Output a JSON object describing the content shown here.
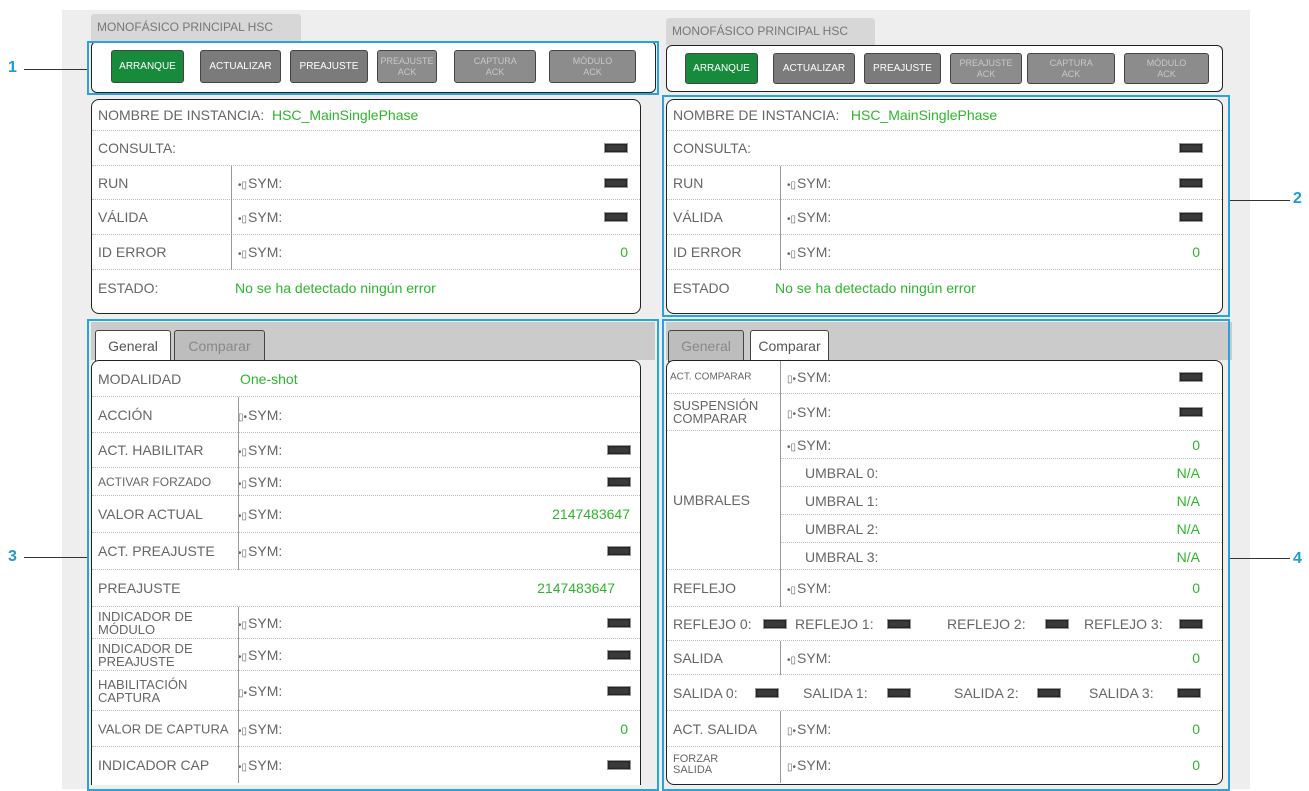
{
  "left": {
    "title": "MONOFÁSICO PRINCIPAL HSC",
    "toolbar": {
      "arranque": "ARRANQUE",
      "actualizar": "ACTUALIZAR",
      "preajuste": "PREAJUSTE",
      "preajuste_ack": "PREAJUSTE ACK",
      "captura_ack": "CAPTURA ACK",
      "modulo_ack": "MÓDULO ACK"
    },
    "instance_label": "NOMBRE DE INSTANCIA:",
    "instance_value": "HSC_MainSinglePhase",
    "consulta": "CONSULTA:",
    "run": "RUN",
    "valida": "VÁLIDA",
    "id_error": "ID ERROR",
    "id_error_value": "0",
    "estado_label": "ESTADO:",
    "estado_value": "No se ha detectado ningún error",
    "sym": "SYM:",
    "tab_general": "General",
    "tab_comparar": "Comparar",
    "modalidad_label": "MODALIDAD",
    "modalidad_value": "One-shot",
    "accion": "ACCIÓN",
    "act_habilitar": "ACT. HABILITAR",
    "activar_forzado": "ACTIVAR FORZADO",
    "valor_actual": "VALOR ACTUAL",
    "valor_actual_value": "2147483647",
    "act_preajuste": "ACT. PREAJUSTE",
    "preajuste_label": "PREAJUSTE",
    "preajuste_value": "2147483647",
    "indicador_modulo": "INDICADOR DE MÓDULO",
    "indicador_preajuste": "INDICADOR DE PREAJUSTE",
    "habilitacion_captura": "HABILITACIÓN CAPTURA",
    "valor_captura": "VALOR DE CAPTURA",
    "valor_captura_value": "0",
    "indicador_cap": "INDICADOR CAP"
  },
  "right": {
    "title": "MONOFÁSICO PRINCIPAL HSC",
    "toolbar": {
      "arranque": "ARRANQUE",
      "actualizar": "ACTUALIZAR",
      "preajuste": "PREAJUSTE",
      "preajuste_ack": "PREAJUSTE ACK",
      "captura_ack": "CAPTURA ACK",
      "modulo_ack": "MÓDULO ACK"
    },
    "instance_label": "NOMBRE DE INSTANCIA:",
    "instance_value": "HSC_MainSinglePhase",
    "consulta": "CONSULTA:",
    "run": "RUN",
    "valida": "VÁLIDA",
    "id_error": "ID ERROR",
    "id_error_value": "0",
    "estado_label": "ESTADO",
    "estado_value": "No se ha detectado ningún error",
    "sym": "SYM:",
    "tab_general": "General",
    "tab_comparar": "Comparar",
    "act_comparar": "ACT. COMPARAR",
    "suspension_comparar": "SUSPENSIÓN COMPARAR",
    "umbrales": "UMBRALES",
    "umbrales_value": "0",
    "umbral0": "UMBRAL 0:",
    "umbral1": "UMBRAL 1:",
    "umbral2": "UMBRAL 2:",
    "umbral3": "UMBRAL 3:",
    "na": "N/A",
    "reflejo": "REFLEJO",
    "reflejo_value": "0",
    "reflejo0": "REFLEJO 0:",
    "reflejo1": "REFLEJO 1:",
    "reflejo2": "REFLEJO 2:",
    "reflejo3": "REFLEJO 3:",
    "salida": "SALIDA",
    "salida_value": "0",
    "salida0": "SALIDA 0:",
    "salida1": "SALIDA 1:",
    "salida2": "SALIDA 2:",
    "salida3": "SALIDA 3:",
    "act_salida": "ACT. SALIDA",
    "act_salida_value": "0",
    "forzar_salida": "FORZAR SALIDA",
    "forzar_salida_value": "0"
  },
  "callouts": {
    "c1": "1",
    "c2": "2",
    "c3": "3",
    "c4": "4"
  },
  "colors": {
    "callout": "#29a3df",
    "value_green": "#2db52d",
    "button_green": "#188a3c"
  }
}
